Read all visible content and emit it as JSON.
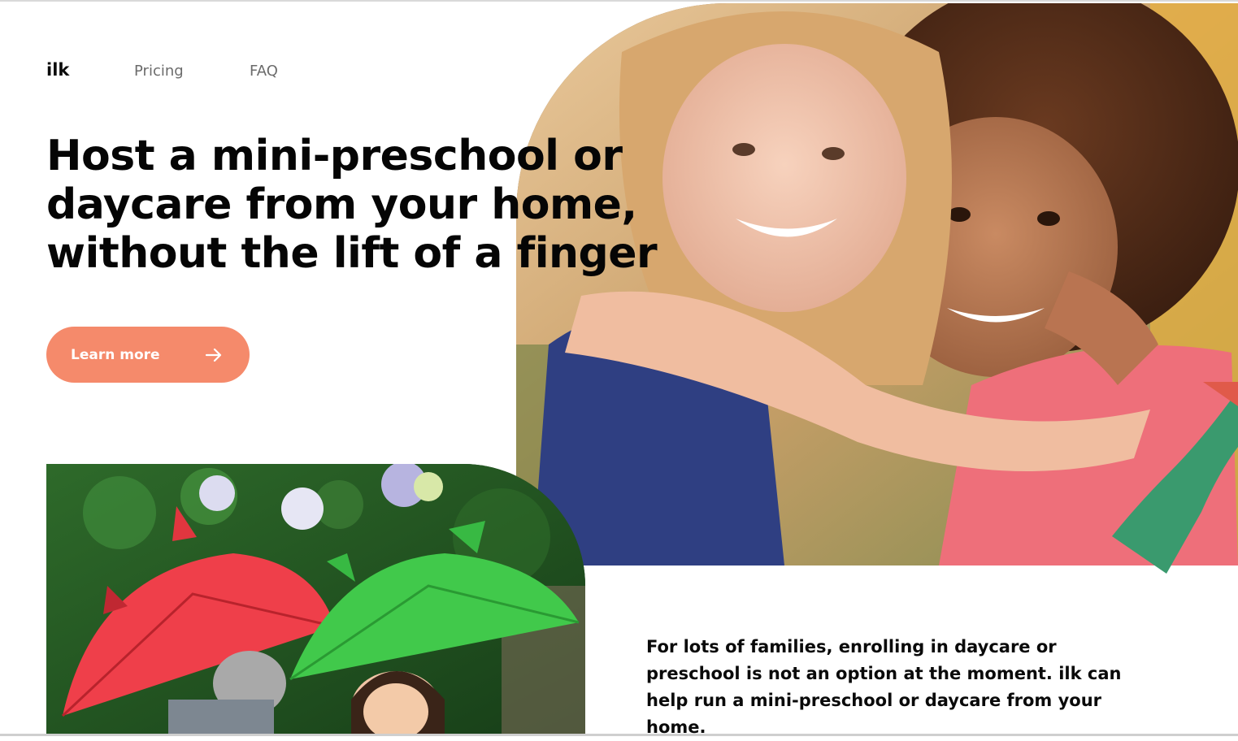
{
  "nav": {
    "logo": "ilk",
    "links": [
      "Pricing",
      "FAQ"
    ]
  },
  "hero": {
    "title": "Host a mini-preschool or daycare from your home, without the lift of a finger",
    "cta_label": "Learn more",
    "cta_icon": "arrow-right-icon"
  },
  "images": {
    "hero_photo": "two-girls-hugging-photo",
    "secondary_photo": "children-with-umbrellas-photo"
  },
  "intro": {
    "text": "For lots of families, enrolling in daycare or preschool is not an option at the moment. ilk can help run a mini-preschool or daycare from your home."
  },
  "colors": {
    "accent": "#f58a6b",
    "stroke_green": "#3a9a6e",
    "stroke_red": "#e05a4a",
    "text": "#050505",
    "nav_muted": "#6b6b6b"
  }
}
